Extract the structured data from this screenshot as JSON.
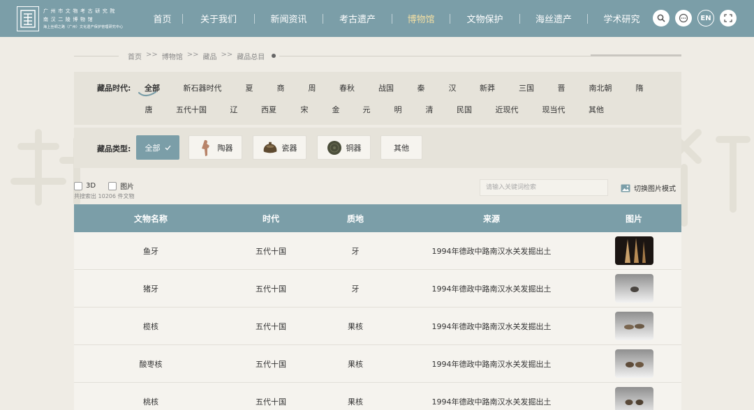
{
  "header": {
    "logo": {
      "line1": "广州市文物考古研究院",
      "line2": "南汉二陵博物馆",
      "line3": "海上丝绸之路（广州）文化遗产保护管理研究中心"
    },
    "nav": [
      {
        "label": "首页",
        "active": false
      },
      {
        "label": "关于我们",
        "active": false
      },
      {
        "label": "新闻资讯",
        "active": false
      },
      {
        "label": "考古遗产",
        "active": false
      },
      {
        "label": "博物馆",
        "active": true
      },
      {
        "label": "文物保护",
        "active": false
      },
      {
        "label": "海丝遗产",
        "active": false
      },
      {
        "label": "学术研究",
        "active": false
      }
    ],
    "tools": {
      "lang": "EN"
    }
  },
  "breadcrumb": [
    {
      "label": "首页"
    },
    {
      "label": "博物馆"
    },
    {
      "label": "藏品"
    },
    {
      "label": "藏品总目"
    }
  ],
  "breadcrumb_sep": ">>",
  "filters": {
    "era_label": "藏品时代:",
    "eras_row1": [
      "全部",
      "新石器时代",
      "夏",
      "商",
      "周",
      "春秋",
      "战国",
      "秦",
      "汉",
      "新莽",
      "三国",
      "晋",
      "南北朝",
      "隋"
    ],
    "eras_row2": [
      "唐",
      "五代十国",
      "辽",
      "西夏",
      "宋",
      "金",
      "元",
      "明",
      "清",
      "民国",
      "近现代",
      "现当代",
      "其他"
    ],
    "era_active": "全部",
    "type_label": "藏品类型:",
    "types": [
      {
        "label": "全部",
        "active": true,
        "icon": "check-icon"
      },
      {
        "label": "陶器",
        "active": false,
        "icon": "pottery-figure-icon"
      },
      {
        "label": "瓷器",
        "active": false,
        "icon": "porcelain-bowl-icon"
      },
      {
        "label": "铜器",
        "active": false,
        "icon": "bronze-mirror-icon"
      },
      {
        "label": "其他",
        "active": false,
        "icon": ""
      }
    ]
  },
  "toolbar": {
    "check_3d": "3D",
    "check_image": "图片",
    "result_count": "共搜索出 10206 件文物",
    "search_placeholder": "请输入关键词检索",
    "view_toggle": "切换图片模式"
  },
  "table": {
    "headers": [
      "文物名称",
      "时代",
      "质地",
      "来源",
      "图片"
    ],
    "rows": [
      {
        "name": "鱼牙",
        "era": "五代十国",
        "material": "牙",
        "source": "1994年德政中路南汉水关发掘出土",
        "thumb": "dark-teeth"
      },
      {
        "name": "猪牙",
        "era": "五代十国",
        "material": "牙",
        "source": "1994年德政中路南汉水关发掘出土",
        "thumb": "single-tooth"
      },
      {
        "name": "榄核",
        "era": "五代十国",
        "material": "果核",
        "source": "1994年德政中路南汉水关发掘出土",
        "thumb": "two-pits"
      },
      {
        "name": "酸枣核",
        "era": "五代十国",
        "material": "果核",
        "source": "1994年德政中路南汉水关发掘出土",
        "thumb": "two-pits"
      },
      {
        "name": "桃核",
        "era": "五代十国",
        "material": "果核",
        "source": "1994年德政中路南汉水关发掘出土",
        "thumb": "two-pits"
      }
    ]
  },
  "colors": {
    "accent": "#7b9ea8",
    "nav_active": "#f3dfa3",
    "page_bg": "#efece5",
    "panel_bg": "#e6e3da"
  }
}
